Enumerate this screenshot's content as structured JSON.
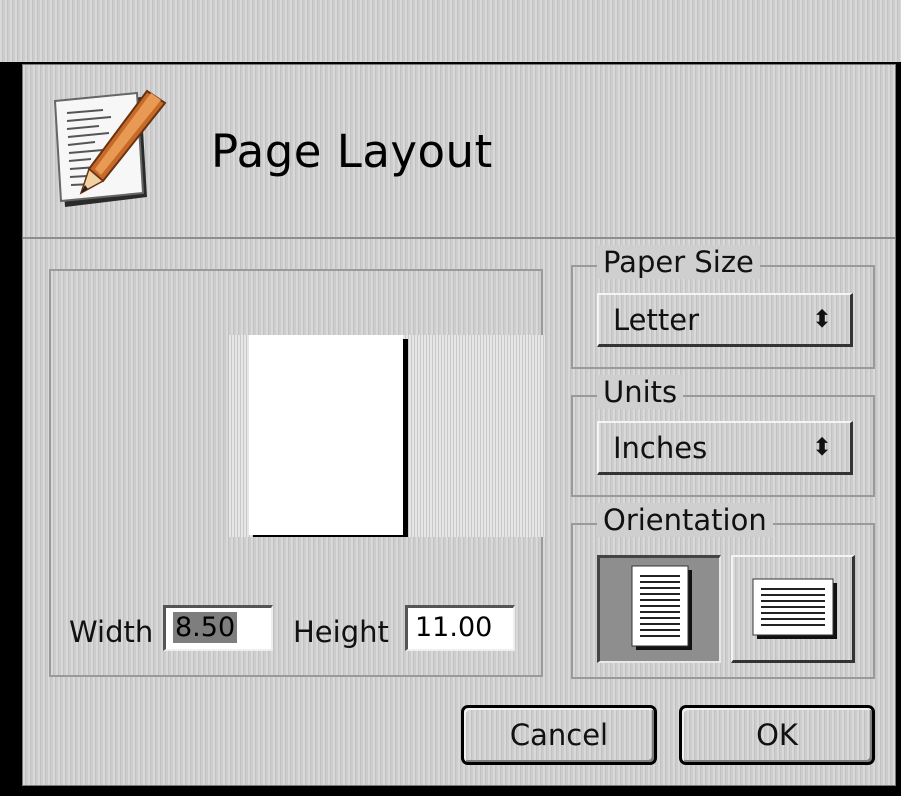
{
  "dialog": {
    "title": "Page Layout"
  },
  "icons": {
    "app": "document-pencil-icon",
    "select_arrows": "up-down-arrows-icon"
  },
  "preview": {
    "width_label": "Width",
    "width_value": "8.50",
    "height_label": "Height",
    "height_value": "11.00"
  },
  "paper_size": {
    "legend": "Paper Size",
    "selected": "Letter"
  },
  "units": {
    "legend": "Units",
    "selected": "Inches"
  },
  "orientation": {
    "legend": "Orientation",
    "selected": "portrait"
  },
  "buttons": {
    "cancel": "Cancel",
    "ok": "OK"
  },
  "colors": {
    "background": "#cfcfcf",
    "selected_value_bg": "#7e7e7e"
  }
}
